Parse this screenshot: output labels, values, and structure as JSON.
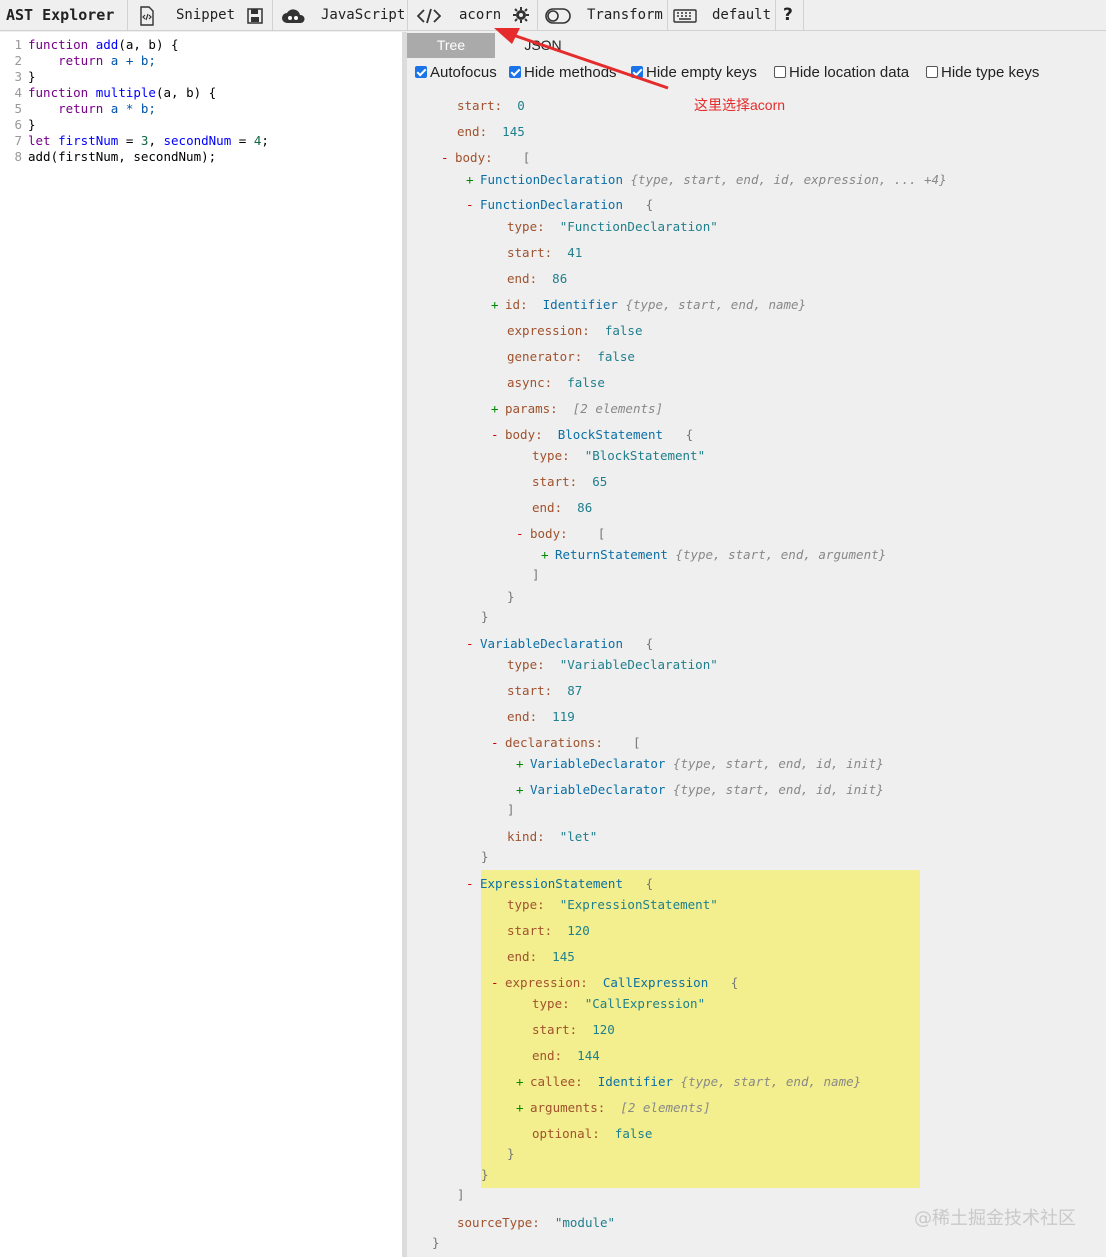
{
  "toolbar": {
    "app_title": "AST Explorer",
    "snippet": "Snippet",
    "language": "JavaScript",
    "parser": "acorn",
    "transform": "Transform",
    "keymap": "default",
    "help": "?"
  },
  "colors": {
    "accent_red": "#e52b2b",
    "highlight": "#f3ef8e"
  },
  "editor": {
    "lines": [
      {
        "n": "1"
      },
      {
        "n": "2"
      },
      {
        "n": "3"
      },
      {
        "n": "4"
      },
      {
        "n": "5"
      },
      {
        "n": "6"
      },
      {
        "n": "7"
      },
      {
        "n": "8"
      }
    ],
    "tokens": {
      "l1": [
        "function",
        "add",
        "(a, b) {"
      ],
      "l2": [
        "return",
        "a + b;"
      ],
      "l3": "}",
      "l4": [
        "function",
        "multiple",
        "(a, b) {"
      ],
      "l5": [
        "return",
        "a * b;"
      ],
      "l6": "}",
      "l7": [
        "let",
        "firstNum",
        " = ",
        "3",
        ", ",
        "secondNum",
        " = ",
        "4",
        ";"
      ],
      "l8": "add(firstNum, secondNum);"
    }
  },
  "tabs": {
    "tree": "Tree",
    "json": "JSON"
  },
  "options": {
    "autofocus": "Autofocus",
    "hide_methods": "Hide methods",
    "hide_empty": "Hide empty keys",
    "hide_location": "Hide location data",
    "hide_type": "Hide type keys"
  },
  "annotation": "这里选择acorn",
  "watermark": "@稀土掘金技术社区",
  "tree": {
    "start": "0",
    "end": "145",
    "fd1_summary": "{type, start, end, id, expression, ... +4}",
    "fd2": {
      "type": "\"FunctionDeclaration\"",
      "start": "41",
      "end": "86",
      "id_summary": "{type, start, end, name}",
      "expression": "false",
      "generator": "false",
      "async": "false",
      "params_summary": "[2 elements]",
      "body_type": "\"BlockStatement\"",
      "body_start": "65",
      "body_end": "86",
      "ret_summary": "{type, start, end, argument}"
    },
    "vd": {
      "type": "\"VariableDeclaration\"",
      "start": "87",
      "end": "119",
      "decl_summary": "{type, start, end, id, init}",
      "kind": "\"let\""
    },
    "es": {
      "type": "\"ExpressionStatement\"",
      "start": "120",
      "end": "145",
      "ce_type": "\"CallExpression\"",
      "ce_start": "120",
      "ce_end": "144",
      "callee_summary": "{type, start, end, name}",
      "args_summary": "[2 elements]",
      "optional": "false"
    },
    "sourceType": "\"module\"",
    "labels": {
      "start": "start",
      "end": "end",
      "body": "body",
      "type": "type",
      "id": "id",
      "expression": "expression",
      "generator": "generator",
      "async": "async",
      "params": "params",
      "declarations": "declarations",
      "kind": "kind",
      "callee": "callee",
      "arguments": "arguments",
      "optional": "optional",
      "sourceType": "sourceType",
      "FunctionDeclaration": "FunctionDeclaration",
      "Identifier": "Identifier",
      "BlockStatement": "BlockStatement",
      "ReturnStatement": "ReturnStatement",
      "VariableDeclaration": "VariableDeclaration",
      "VariableDeclarator": "VariableDeclarator",
      "ExpressionStatement": "ExpressionStatement",
      "CallExpression": "CallExpression"
    }
  }
}
